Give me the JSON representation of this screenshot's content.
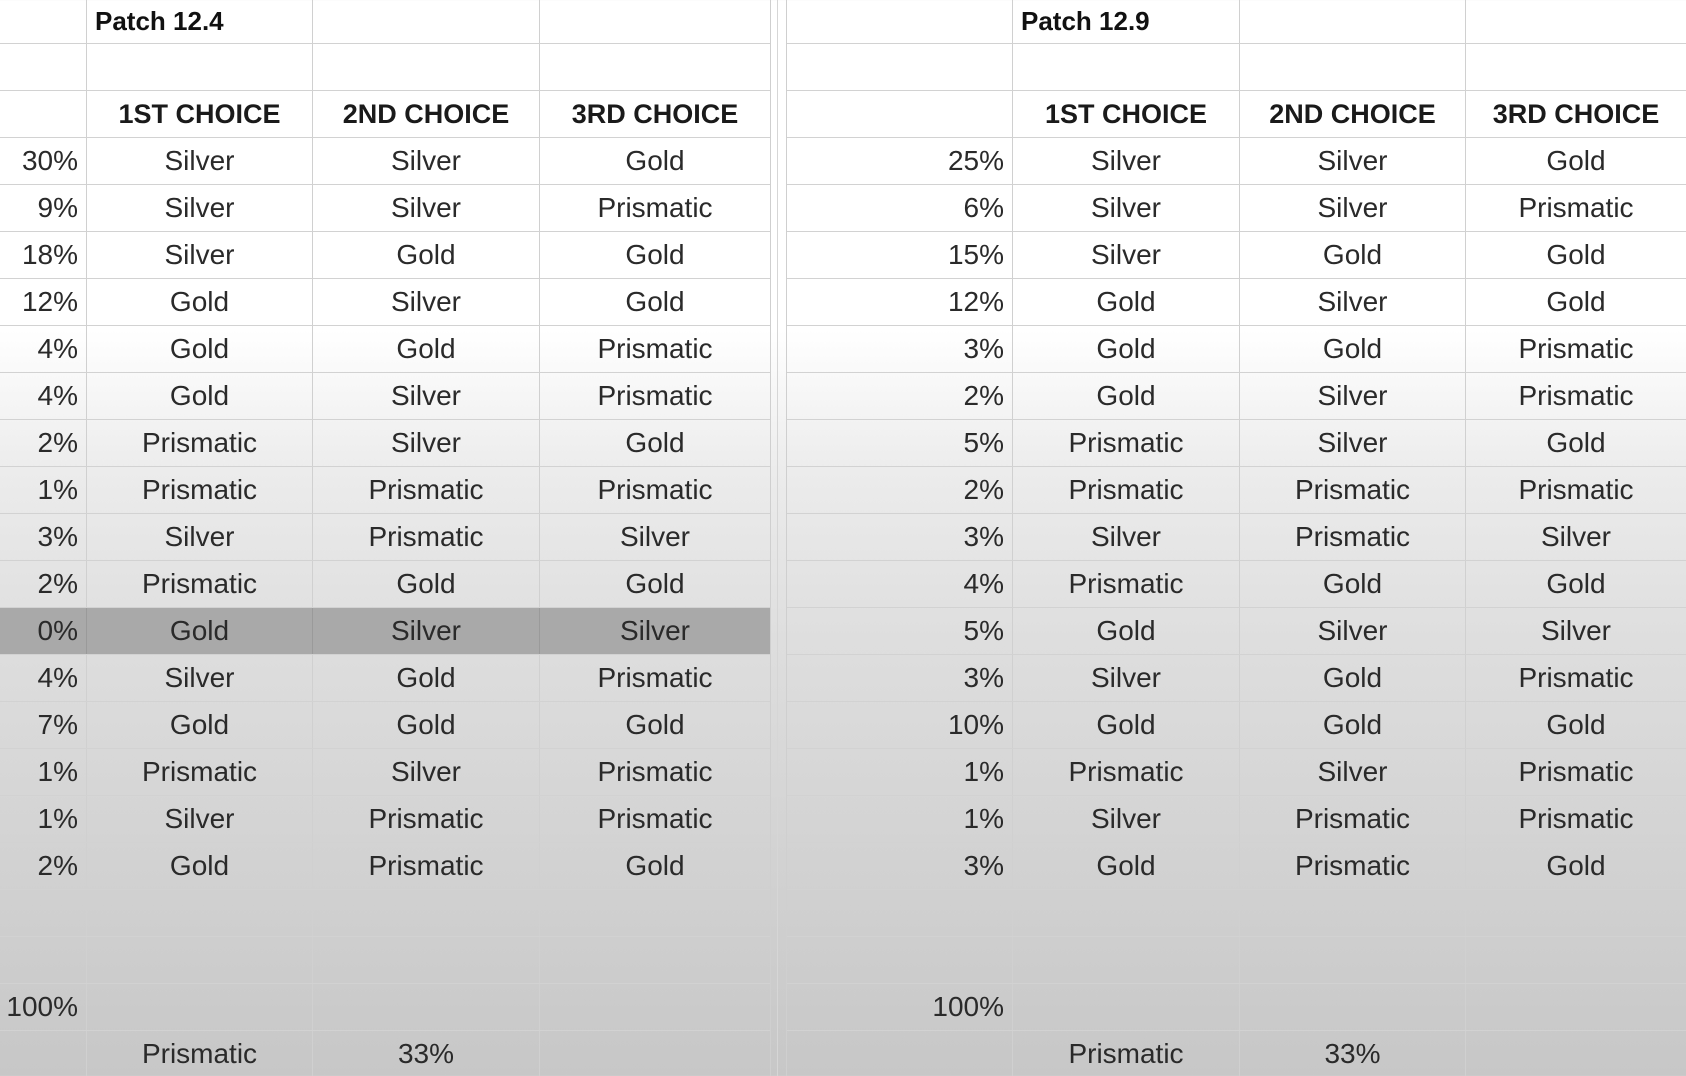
{
  "tables": [
    {
      "title": "Patch 12.4",
      "headers": [
        "1ST CHOICE",
        "2ND CHOICE",
        "3RD CHOICE"
      ],
      "rows": [
        {
          "pct": "30%",
          "c1": "Silver",
          "c2": "Silver",
          "c3": "Gold"
        },
        {
          "pct": "9%",
          "c1": "Silver",
          "c2": "Silver",
          "c3": "Prismatic"
        },
        {
          "pct": "18%",
          "c1": "Silver",
          "c2": "Gold",
          "c3": "Gold"
        },
        {
          "pct": "12%",
          "c1": "Gold",
          "c2": "Silver",
          "c3": "Gold"
        },
        {
          "pct": "4%",
          "c1": "Gold",
          "c2": "Gold",
          "c3": "Prismatic"
        },
        {
          "pct": "4%",
          "c1": "Gold",
          "c2": "Silver",
          "c3": "Prismatic"
        },
        {
          "pct": "2%",
          "c1": "Prismatic",
          "c2": "Silver",
          "c3": "Gold"
        },
        {
          "pct": "1%",
          "c1": "Prismatic",
          "c2": "Prismatic",
          "c3": "Prismatic"
        },
        {
          "pct": "3%",
          "c1": "Silver",
          "c2": "Prismatic",
          "c3": "Silver"
        },
        {
          "pct": "2%",
          "c1": "Prismatic",
          "c2": "Gold",
          "c3": "Gold"
        },
        {
          "pct": "0%",
          "c1": "Gold",
          "c2": "Silver",
          "c3": "Silver",
          "highlighted": true
        },
        {
          "pct": "4%",
          "c1": "Silver",
          "c2": "Gold",
          "c3": "Prismatic"
        },
        {
          "pct": "7%",
          "c1": "Gold",
          "c2": "Gold",
          "c3": "Gold"
        },
        {
          "pct": "1%",
          "c1": "Prismatic",
          "c2": "Silver",
          "c3": "Prismatic"
        },
        {
          "pct": "1%",
          "c1": "Silver",
          "c2": "Prismatic",
          "c3": "Prismatic"
        },
        {
          "pct": "2%",
          "c1": "Gold",
          "c2": "Prismatic",
          "c3": "Gold"
        }
      ],
      "total": "100%",
      "summary": {
        "label": "Prismatic",
        "value": "33%"
      }
    },
    {
      "title": "Patch 12.9",
      "headers": [
        "1ST CHOICE",
        "2ND CHOICE",
        "3RD CHOICE"
      ],
      "rows": [
        {
          "pct": "25%",
          "c1": "Silver",
          "c2": "Silver",
          "c3": "Gold"
        },
        {
          "pct": "6%",
          "c1": "Silver",
          "c2": "Silver",
          "c3": "Prismatic"
        },
        {
          "pct": "15%",
          "c1": "Silver",
          "c2": "Gold",
          "c3": "Gold"
        },
        {
          "pct": "12%",
          "c1": "Gold",
          "c2": "Silver",
          "c3": "Gold"
        },
        {
          "pct": "3%",
          "c1": "Gold",
          "c2": "Gold",
          "c3": "Prismatic"
        },
        {
          "pct": "2%",
          "c1": "Gold",
          "c2": "Silver",
          "c3": "Prismatic"
        },
        {
          "pct": "5%",
          "c1": "Prismatic",
          "c2": "Silver",
          "c3": "Gold"
        },
        {
          "pct": "2%",
          "c1": "Prismatic",
          "c2": "Prismatic",
          "c3": "Prismatic"
        },
        {
          "pct": "3%",
          "c1": "Silver",
          "c2": "Prismatic",
          "c3": "Silver"
        },
        {
          "pct": "4%",
          "c1": "Prismatic",
          "c2": "Gold",
          "c3": "Gold"
        },
        {
          "pct": "5%",
          "c1": "Gold",
          "c2": "Silver",
          "c3": "Silver"
        },
        {
          "pct": "3%",
          "c1": "Silver",
          "c2": "Gold",
          "c3": "Prismatic"
        },
        {
          "pct": "10%",
          "c1": "Gold",
          "c2": "Gold",
          "c3": "Gold"
        },
        {
          "pct": "1%",
          "c1": "Prismatic",
          "c2": "Silver",
          "c3": "Prismatic"
        },
        {
          "pct": "1%",
          "c1": "Silver",
          "c2": "Prismatic",
          "c3": "Prismatic"
        },
        {
          "pct": "3%",
          "c1": "Gold",
          "c2": "Prismatic",
          "c3": "Gold"
        }
      ],
      "total": "100%",
      "summary": {
        "label": "Prismatic",
        "value": "33%"
      }
    }
  ],
  "colors": {
    "highlight_row": "#a9a9a9",
    "text": "#2a2a2a",
    "gridline": "#d0d0d0"
  }
}
